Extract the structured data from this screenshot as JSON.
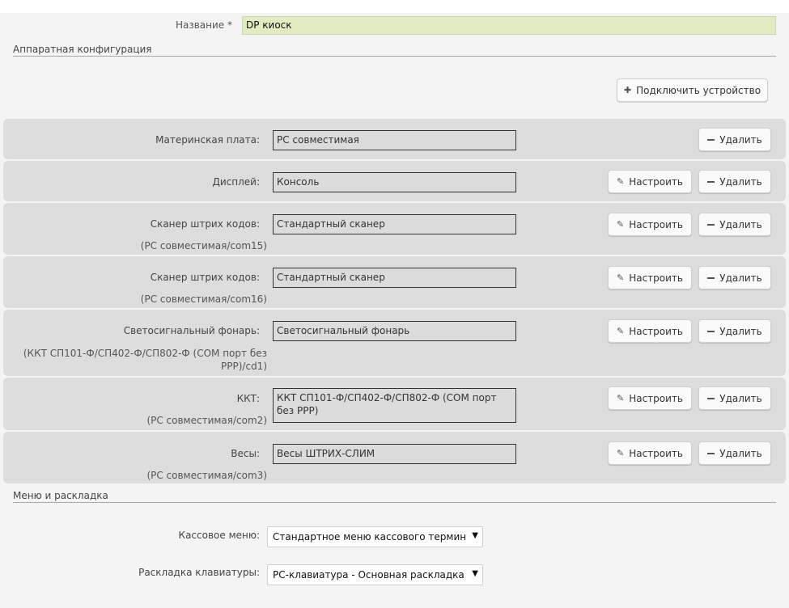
{
  "name_field": {
    "label": "Название *",
    "value": "DP киоск"
  },
  "hardware": {
    "section_title": "Аппаратная конфигурация",
    "connect_button": "Подключить устройство",
    "configure_label": "Настроить",
    "delete_label": "Удалить",
    "devices": [
      {
        "label": "Материнская плата:",
        "value": "PC совместимая",
        "sub": ""
      },
      {
        "label": "Дисплей:",
        "value": "Консоль",
        "sub": ""
      },
      {
        "label": "Сканер штрих кодов:",
        "value": "Стандартный сканер",
        "sub": "(PC совместимая/com15)"
      },
      {
        "label": "Сканер штрих кодов:",
        "value": "Стандартный сканер",
        "sub": "(PC совместимая/com16)"
      },
      {
        "label": "Светосигнальный фонарь:",
        "value": "Светосигнальный фонарь",
        "sub_line1": "(ККТ СП101-Ф/СП402-Ф/СП802-Ф (COM порт без",
        "sub_line2": "PPP)/cd1)"
      },
      {
        "label": "ККТ:",
        "value": "ККТ СП101-Ф/СП402-Ф/СП802-Ф (COM порт без PPP)",
        "sub": "(PC совместимая/com2)"
      },
      {
        "label": "Весы:",
        "value": "Весы ШТРИХ-СЛИМ",
        "sub": "(PC совместимая/com3)"
      }
    ]
  },
  "menu_layout": {
    "section_title": "Меню и раскладка",
    "cash_menu": {
      "label": "Кассовое меню:",
      "value": "Стандартное меню кассового терминала"
    },
    "keyboard_layout": {
      "label": "Раскладка клавиатуры:",
      "value": "PC-клавиатура - Основная раскладка клавиатуры"
    }
  },
  "icons": {
    "plus": "plus-icon",
    "pencil": "pencil-icon",
    "minus": "minus-icon",
    "caret": "caret-down-icon"
  },
  "colors": {
    "name_input_bg": "#e2ecc3",
    "row_bg": "#dddddd",
    "warning": "#d01010"
  }
}
